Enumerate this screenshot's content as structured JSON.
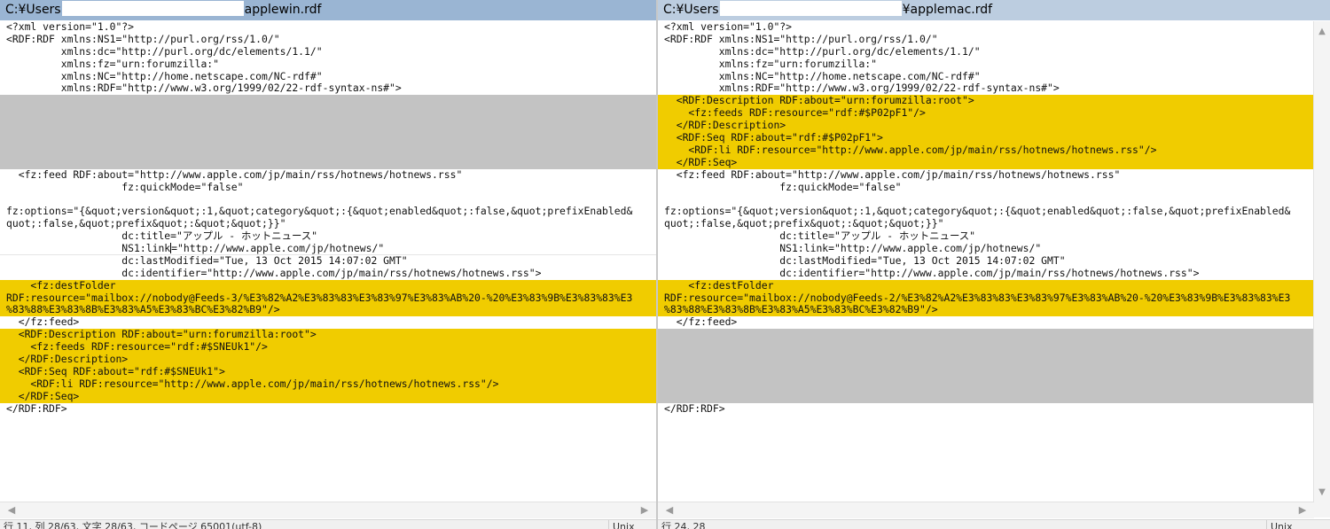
{
  "left": {
    "title_prefix": "C:¥Users",
    "title_suffix": "applewin.rdf",
    "lines": [
      {
        "text": "<?xml version=\"1.0\"?>",
        "type": "normal"
      },
      {
        "text": "<RDF:RDF xmlns:NS1=\"http://purl.org/rss/1.0/\"",
        "type": "normal"
      },
      {
        "text": "         xmlns:dc=\"http://purl.org/dc/elements/1.1/\"",
        "type": "normal"
      },
      {
        "text": "         xmlns:fz=\"urn:forumzilla:\"",
        "type": "normal"
      },
      {
        "text": "         xmlns:NC=\"http://home.netscape.com/NC-rdf#\"",
        "type": "normal"
      },
      {
        "text": "         xmlns:RDF=\"http://www.w3.org/1999/02/22-rdf-syntax-ns#\">",
        "type": "normal"
      },
      {
        "text": "",
        "type": "gray"
      },
      {
        "text": "",
        "type": "gray"
      },
      {
        "text": "",
        "type": "gray"
      },
      {
        "text": "",
        "type": "gray"
      },
      {
        "text": "",
        "type": "gray"
      },
      {
        "text": "",
        "type": "gray"
      },
      {
        "text": "  <fz:feed RDF:about=\"http://www.apple.com/jp/main/rss/hotnews/hotnews.rss\"",
        "type": "normal"
      },
      {
        "text": "                   fz:quickMode=\"false\"",
        "type": "normal"
      },
      {
        "text": "",
        "type": "normal"
      },
      {
        "text": "fz:options=\"{&quot;version&quot;:1,&quot;category&quot;:{&quot;enabled&quot;:false,&quot;prefixEnabled&",
        "type": "normal"
      },
      {
        "text": "quot;:false,&quot;prefix&quot;:&quot;&quot;}}\"",
        "type": "normal"
      },
      {
        "text": "                   dc:title=\"アップル - ホットニュース\"",
        "type": "normal"
      },
      {
        "text": "                   NS1:link",
        "type": "cursor",
        "after": "=\"http://www.apple.com/jp/hotnews/\""
      },
      {
        "text": "                   dc:lastModified=\"Tue, 13 Oct 2015 14:07:02 GMT\"",
        "type": "normal"
      },
      {
        "text": "                   dc:identifier=\"http://www.apple.com/jp/main/rss/hotnews/hotnews.rss\">",
        "type": "normal"
      },
      {
        "text": "    <fz:destFolder",
        "type": "hl"
      },
      {
        "text": "RDF:resource=\"mailbox://nobody@Feeds-3/%E3%82%A2%E3%83%83%E3%83%97%E3%83%AB%20-%20%E3%83%9B%E3%83%83%E3",
        "type": "hl"
      },
      {
        "text": "%83%88%E3%83%8B%E3%83%A5%E3%83%BC%E3%82%B9\"/>",
        "type": "hl"
      },
      {
        "text": "  </fz:feed>",
        "type": "normal"
      },
      {
        "text": "  <RDF:Description RDF:about=\"urn:forumzilla:root\">",
        "type": "hl"
      },
      {
        "text": "    <fz:feeds RDF:resource=\"rdf:#$SNEUk1\"/>",
        "type": "hl"
      },
      {
        "text": "  </RDF:Description>",
        "type": "hl"
      },
      {
        "text": "  <RDF:Seq RDF:about=\"rdf:#$SNEUk1\">",
        "type": "hl"
      },
      {
        "text": "    <RDF:li RDF:resource=\"http://www.apple.com/jp/main/rss/hotnews/hotnews.rss\"/>",
        "type": "hl"
      },
      {
        "text": "  </RDF:Seq>",
        "type": "hl"
      },
      {
        "text": "</RDF:RDF>",
        "type": "normal"
      }
    ],
    "status": "行 11, 列 28/63, 文字 28/63, コードページ 65001(utf-8)",
    "status_enc": "Unix"
  },
  "right": {
    "title_prefix": "C:¥Users",
    "title_suffix": "¥applemac.rdf",
    "lines": [
      {
        "text": "<?xml version=\"1.0\"?>",
        "type": "normal"
      },
      {
        "text": "<RDF:RDF xmlns:NS1=\"http://purl.org/rss/1.0/\"",
        "type": "normal"
      },
      {
        "text": "         xmlns:dc=\"http://purl.org/dc/elements/1.1/\"",
        "type": "normal"
      },
      {
        "text": "         xmlns:fz=\"urn:forumzilla:\"",
        "type": "normal"
      },
      {
        "text": "         xmlns:NC=\"http://home.netscape.com/NC-rdf#\"",
        "type": "normal"
      },
      {
        "text": "         xmlns:RDF=\"http://www.w3.org/1999/02/22-rdf-syntax-ns#\">",
        "type": "normal"
      },
      {
        "text": "  <RDF:Description RDF:about=\"urn:forumzilla:root\">",
        "type": "hl"
      },
      {
        "text": "    <fz:feeds RDF:resource=\"rdf:#$P02pF1\"/>",
        "type": "hl"
      },
      {
        "text": "  </RDF:Description>",
        "type": "hl"
      },
      {
        "text": "  <RDF:Seq RDF:about=\"rdf:#$P02pF1\">",
        "type": "hl"
      },
      {
        "text": "    <RDF:li RDF:resource=\"http://www.apple.com/jp/main/rss/hotnews/hotnews.rss\"/>",
        "type": "hl"
      },
      {
        "text": "  </RDF:Seq>",
        "type": "hl"
      },
      {
        "text": "  <fz:feed RDF:about=\"http://www.apple.com/jp/main/rss/hotnews/hotnews.rss\"",
        "type": "normal"
      },
      {
        "text": "                   fz:quickMode=\"false\"",
        "type": "normal"
      },
      {
        "text": "",
        "type": "normal"
      },
      {
        "text": "fz:options=\"{&quot;version&quot;:1,&quot;category&quot;:{&quot;enabled&quot;:false,&quot;prefixEnabled&",
        "type": "normal"
      },
      {
        "text": "quot;:false,&quot;prefix&quot;:&quot;&quot;}}\"",
        "type": "normal"
      },
      {
        "text": "                   dc:title=\"アップル - ホットニュース\"",
        "type": "normal"
      },
      {
        "text": "                   NS1:link=\"http://www.apple.com/jp/hotnews/\"",
        "type": "normal"
      },
      {
        "text": "                   dc:lastModified=\"Tue, 13 Oct 2015 14:07:02 GMT\"",
        "type": "normal"
      },
      {
        "text": "                   dc:identifier=\"http://www.apple.com/jp/main/rss/hotnews/hotnews.rss\">",
        "type": "normal"
      },
      {
        "text": "    <fz:destFolder",
        "type": "hl"
      },
      {
        "text": "RDF:resource=\"mailbox://nobody@Feeds-2/%E3%82%A2%E3%83%83%E3%83%97%E3%83%AB%20-%20%E3%83%9B%E3%83%83%E3",
        "type": "hl"
      },
      {
        "text": "%83%88%E3%83%8B%E3%83%A5%E3%83%BC%E3%82%B9\"/>",
        "type": "hl"
      },
      {
        "text": "  </fz:feed>",
        "type": "normal"
      },
      {
        "text": "",
        "type": "gray"
      },
      {
        "text": "",
        "type": "gray"
      },
      {
        "text": "",
        "type": "gray"
      },
      {
        "text": "",
        "type": "gray"
      },
      {
        "text": "",
        "type": "gray"
      },
      {
        "text": "",
        "type": "gray"
      },
      {
        "text": "</RDF:RDF>",
        "type": "normal"
      }
    ],
    "status": "行 24, 28",
    "status_enc": "Unix"
  },
  "icons": {
    "scroll_left": "◀",
    "scroll_right": "▶",
    "scroll_up": "▲",
    "scroll_down": "▼"
  }
}
